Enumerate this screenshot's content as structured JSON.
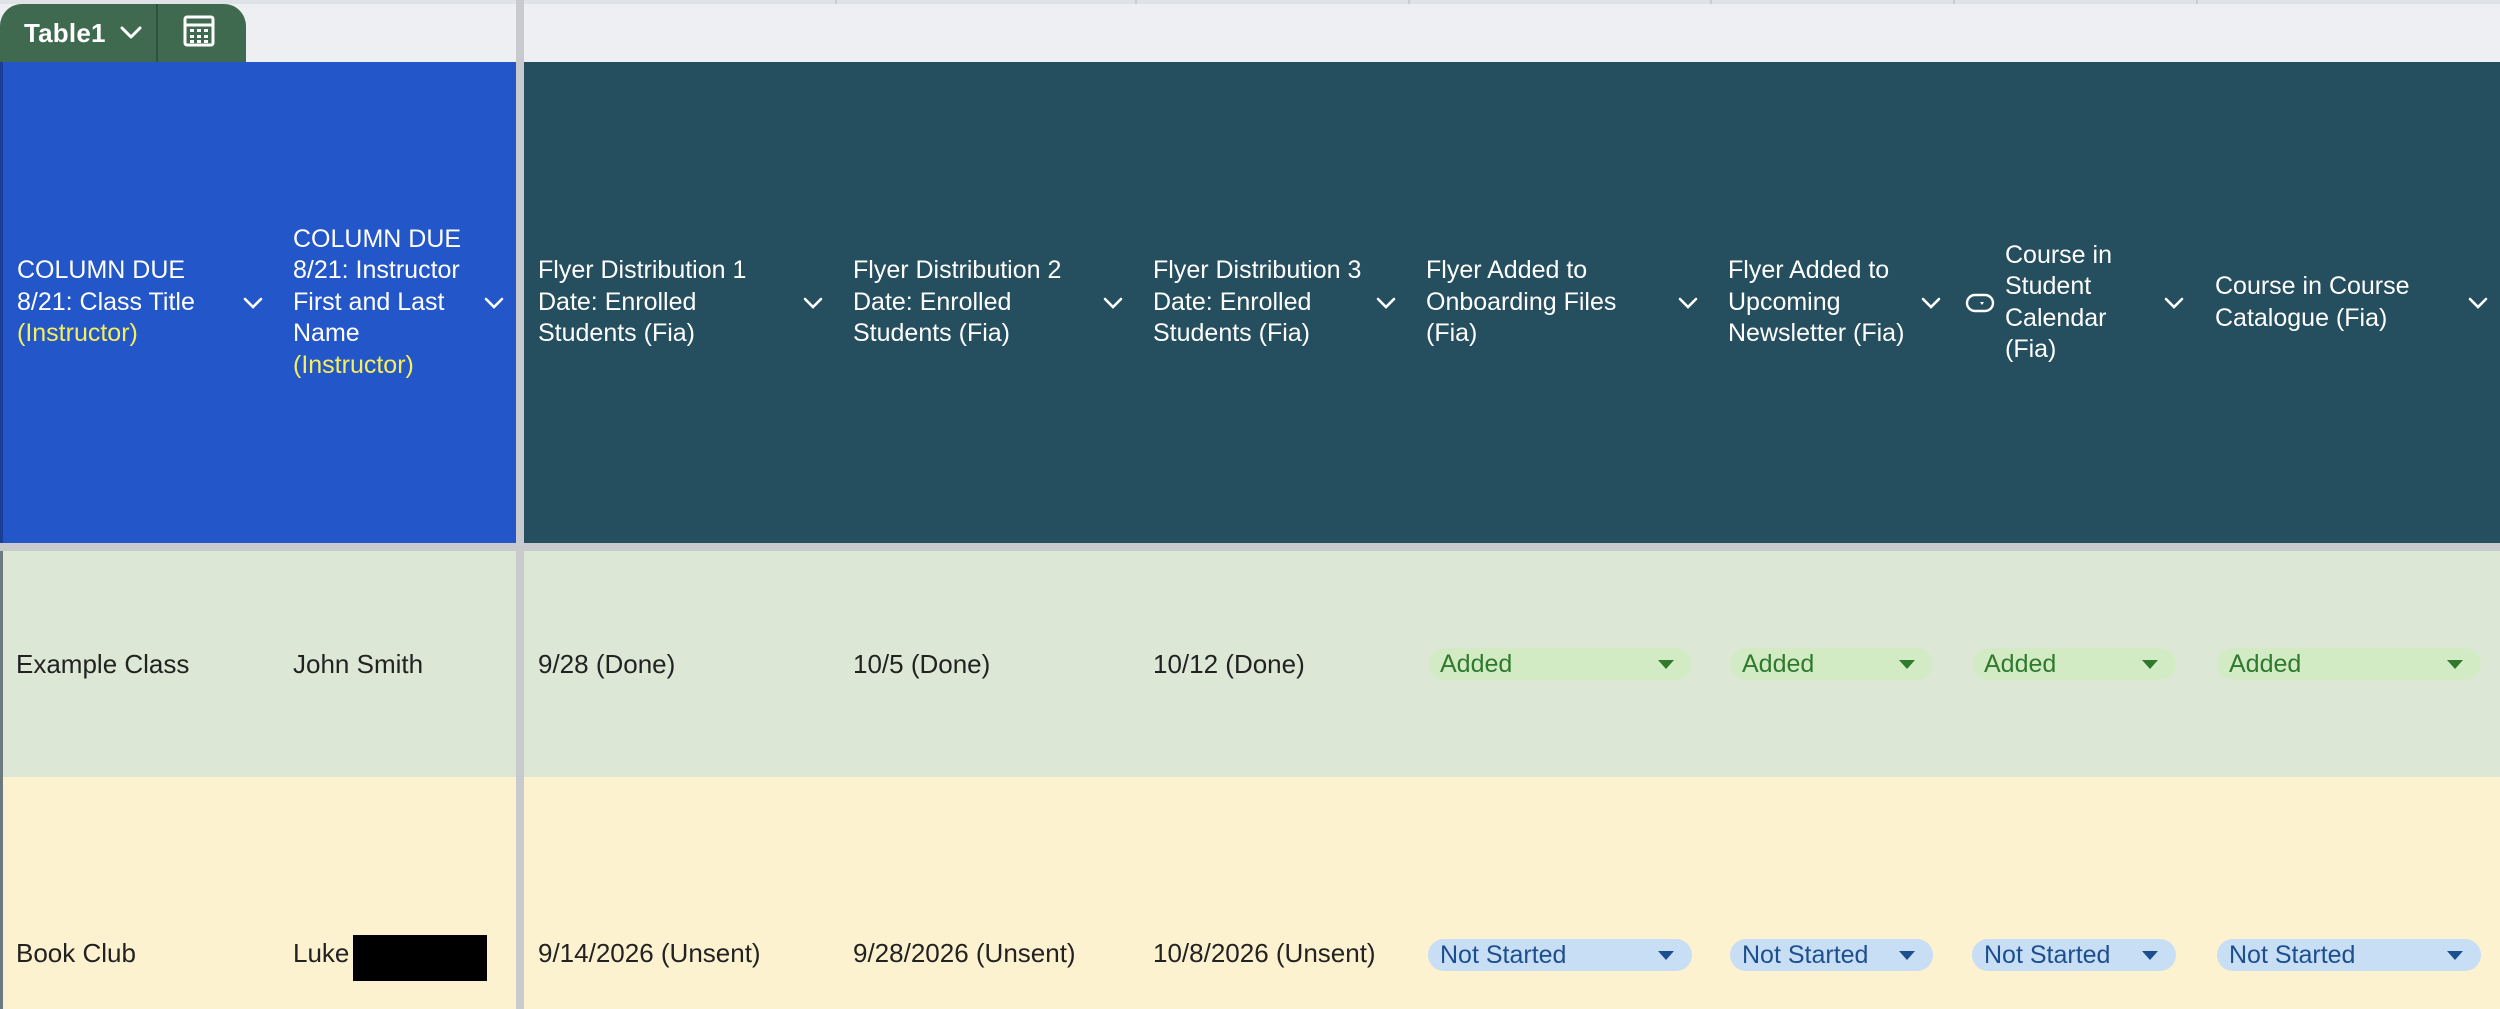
{
  "table_tab": {
    "name": "Table1",
    "chevron_icon": "chevron-down-icon",
    "calc_icon": "calculator-icon"
  },
  "columns": [
    {
      "title_main": "COLUMN DUE 8/21: Class Title",
      "title_hl": "(Instructor)",
      "frozen": true
    },
    {
      "title_main": "COLUMN DUE 8/21: Instructor First and Last Name",
      "title_hl": "(Instructor)",
      "frozen": true
    },
    {
      "title_main": "Flyer Distribution 1 Date: Enrolled Students (Fia)",
      "title_hl": ""
    },
    {
      "title_main": "Flyer Distribution 2 Date: Enrolled Students (Fia)",
      "title_hl": ""
    },
    {
      "title_main": "Flyer Distribution 3 Date: Enrolled Students (Fia)",
      "title_hl": ""
    },
    {
      "title_main": "Flyer Added to Onboarding Files (Fia)",
      "title_hl": ""
    },
    {
      "title_main": "Flyer Added to Upcoming Newsletter (Fia)",
      "title_hl": ""
    },
    {
      "title_main": "Course in Student Calendar (Fia)",
      "title_hl": "",
      "icon": "dropdown-type-icon"
    },
    {
      "title_main": "Course in Course Catalogue (Fia)",
      "title_hl": ""
    }
  ],
  "rows": [
    {
      "class_title": "Example Class",
      "instructor": "John Smith",
      "dist1": "9/28 (Done)",
      "dist2": "10/5 (Done)",
      "dist3": "10/12 (Done)",
      "onboarding": "Added",
      "newsletter": "Added",
      "calendar": "Added",
      "catalogue": "Added"
    },
    {
      "class_title": "Book Club",
      "instructor": "Luke",
      "dist1": "9/14/2026 (Unsent)",
      "dist2": "9/28/2026 (Unsent)",
      "dist3": "10/8/2026 (Unsent)",
      "onboarding": "Not Started",
      "newsletter": "Not Started",
      "calendar": "Not Started",
      "catalogue": "Not Started"
    }
  ],
  "colors": {
    "frozen_header": "#2356c9",
    "header": "#254e5e",
    "highlight_text": "#f6ef5a",
    "row_done": "#dce8d5",
    "row_pending": "#fdf2cf",
    "chip_added": "#d3ebc5",
    "chip_not_started": "#c7def4"
  }
}
